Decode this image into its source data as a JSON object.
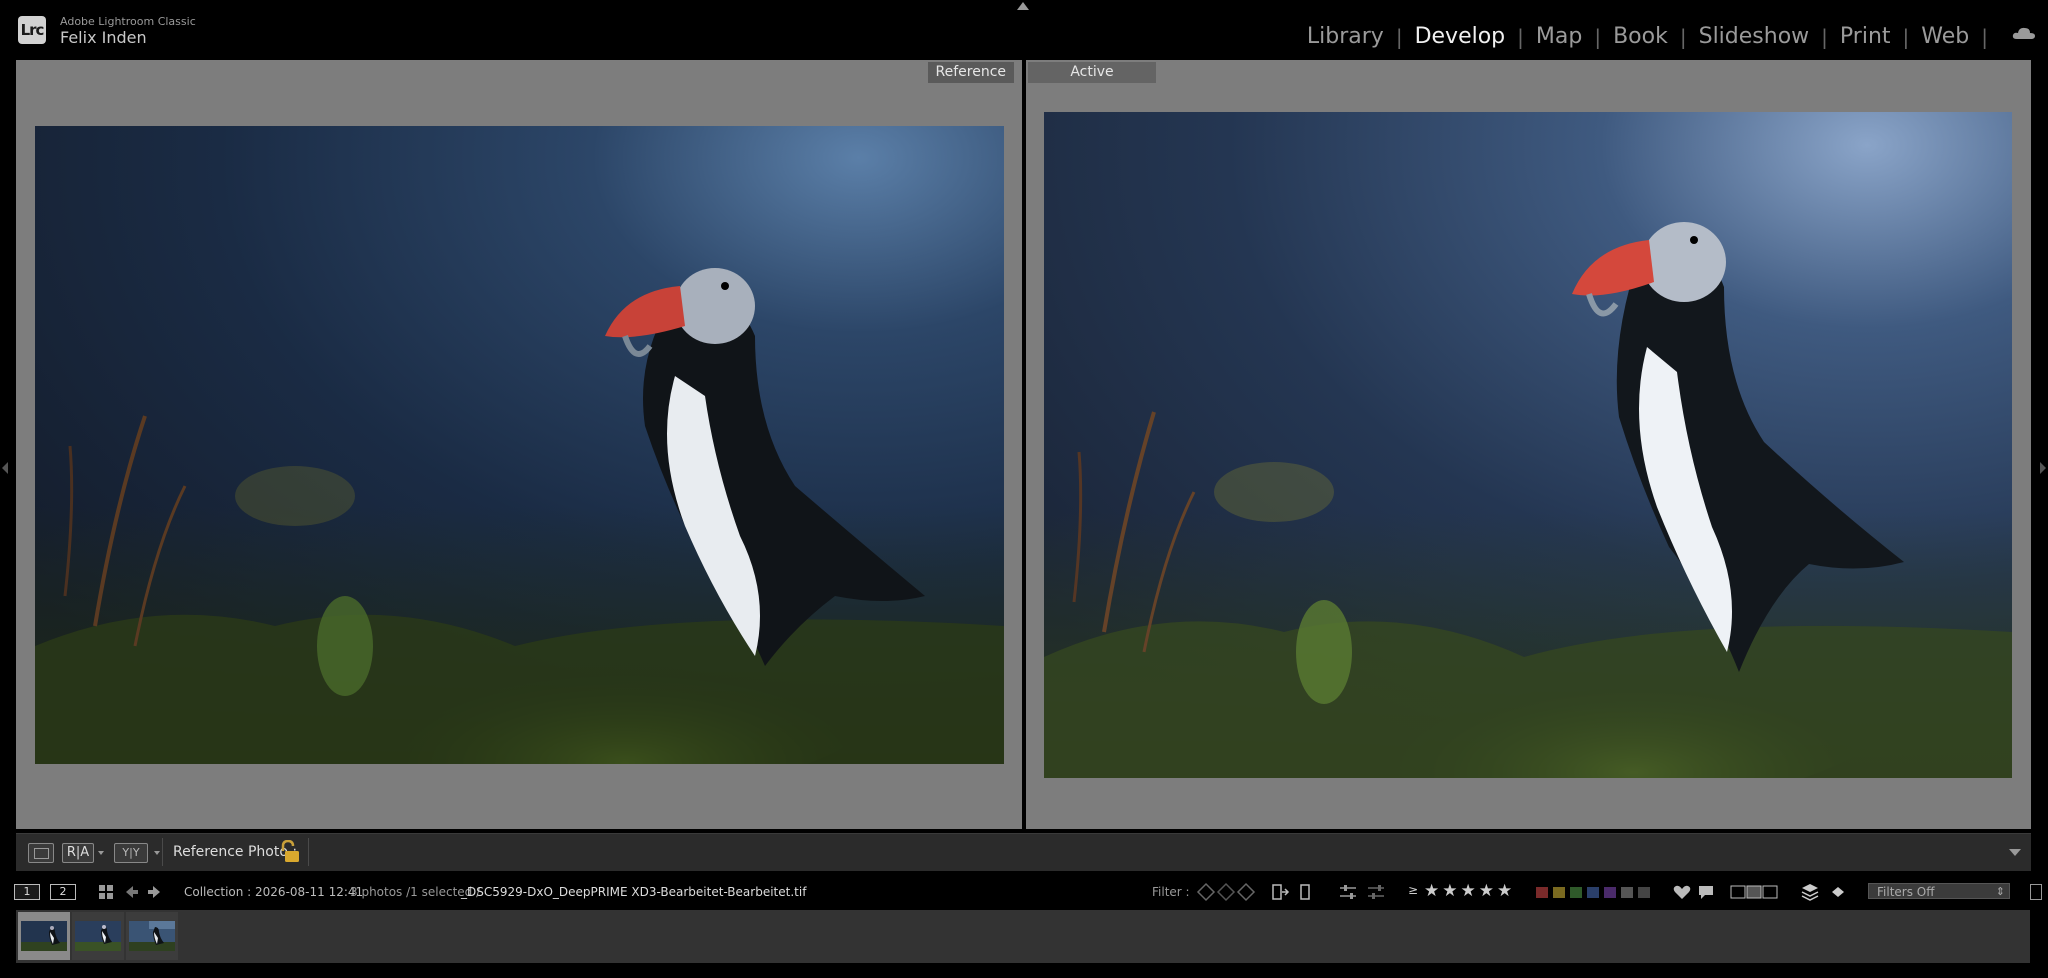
{
  "app": {
    "logo_text": "Lrc",
    "name": "Adobe Lightroom Classic",
    "user": "Felix Inden"
  },
  "modules": [
    {
      "label": "Library",
      "active": false
    },
    {
      "label": "Develop",
      "active": true
    },
    {
      "label": "Map",
      "active": false
    },
    {
      "label": "Book",
      "active": false
    },
    {
      "label": "Slideshow",
      "active": false
    },
    {
      "label": "Print",
      "active": false
    },
    {
      "label": "Web",
      "active": false
    }
  ],
  "cloud_icon": "cloud-icon",
  "compare": {
    "reference_label": "Reference",
    "active_label": "Active"
  },
  "toolbar": {
    "view_single_icon": "loupe-view-icon",
    "view_ra_label": "R|A",
    "view_ty_label": "Y|Y",
    "reference_photo_label": "Reference Photo :",
    "lock_icon": "lock-open-icon"
  },
  "filmstrip_bar": {
    "screen1": "1",
    "screen2": "2",
    "source": "Collection : 2026-08-11 12:41",
    "count": "3 photos /1 selected /",
    "file": "_DSC5929-DxO_DeepPRIME XD3-Bearbeitet-Bearbeitet.tif",
    "filter_label": "Filter :",
    "rating_operator": "≥",
    "rating_stars": "★★★★★",
    "filter_preset": "Filters Off",
    "label_colors": [
      "#7a2a2a",
      "#7a6a20",
      "#2f5a2a",
      "#2a3f6a",
      "#4a2a6a",
      "#555555",
      "#444444"
    ]
  },
  "filmstrip": {
    "thumbnails": [
      {
        "selected": true
      },
      {
        "selected": false
      },
      {
        "selected": false
      }
    ]
  },
  "colors": {
    "pane_gray": "#7d7d7d",
    "toolbar_gray": "#2b2b2b",
    "filmstrip_gray": "#333333",
    "sky": "#1c2c44",
    "foliage": "#3d5a1a"
  }
}
